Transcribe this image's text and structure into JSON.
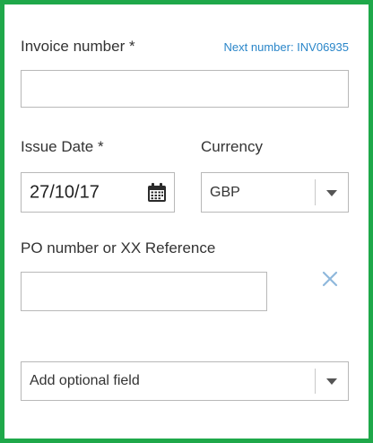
{
  "invoice": {
    "label": "Invoice number *",
    "next_number": "Next number: INV06935",
    "value": ""
  },
  "issue_date": {
    "label": "Issue Date *",
    "value": "27/10/17"
  },
  "currency": {
    "label": "Currency",
    "selected": "GBP"
  },
  "po_reference": {
    "label": "PO number or XX Reference",
    "value": ""
  },
  "optional_field": {
    "selected": "Add optional field"
  },
  "colors": {
    "frame_border": "#1fa84a",
    "link": "#2a86c9",
    "close_icon": "#8fb8dc"
  },
  "icons": {
    "calendar": "calendar-icon",
    "remove": "close-icon",
    "dropdown": "chevron-down-icon"
  }
}
